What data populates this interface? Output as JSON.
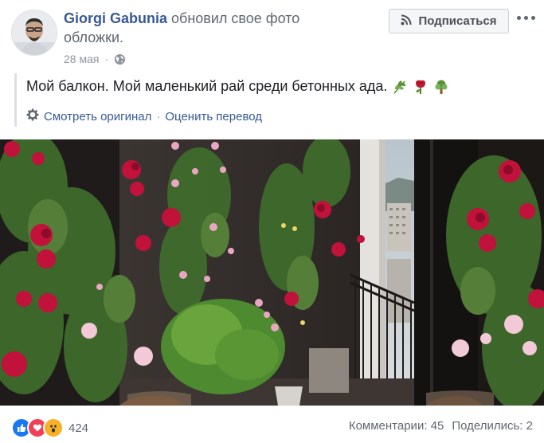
{
  "post": {
    "author": "Giorgi Gabunia",
    "action": " обновил свое фото обложки.",
    "date": "28 мая",
    "privacy_icon": "globe-icon",
    "subscribe_label": "Подписаться",
    "message": "Мой балкон. Мой маленький рай среди бетонных ада.",
    "message_emojis": [
      "herb-icon",
      "rose-icon",
      "tree-icon"
    ],
    "see_original": "Смотреть оригинал",
    "rate_translation": "Оценить перевод",
    "separator": "·",
    "reactions": {
      "icons": [
        "like-icon",
        "love-icon",
        "wow-icon"
      ],
      "count": "424"
    },
    "comments": "Комментарии: 45",
    "shares": "Поделились: 2"
  },
  "colors": {
    "link": "#385898",
    "secondary_text": "#606770",
    "like": "#1877f2",
    "love": "#f33e58",
    "wow": "#f7b125"
  }
}
